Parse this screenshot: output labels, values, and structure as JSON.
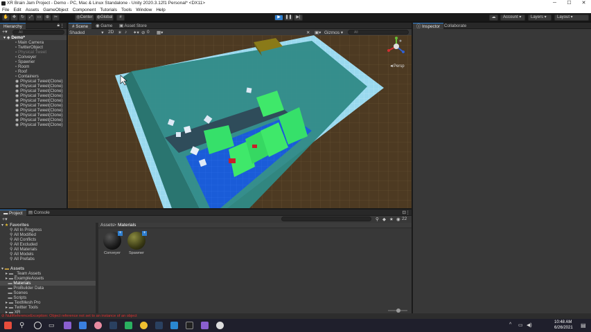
{
  "window": {
    "title": "XR Brain Jam Project - Demo - PC, Mac & Linux Standalone - Unity 2020.3.12f1 Personal* <DX11>",
    "minimize": "─",
    "maximize": "☐",
    "close": "✕"
  },
  "menu": [
    "File",
    "Edit",
    "Assets",
    "GameObject",
    "Component",
    "Tutorials",
    "Tools",
    "Window",
    "Help"
  ],
  "toolbar": {
    "center": "Center",
    "global": "Global",
    "account": "Account",
    "layers": "Layers",
    "layout": "Layout"
  },
  "hierarchy": {
    "tab": "Hierarchy",
    "search_placeholder": "All",
    "scene": "Demo*",
    "items": [
      "Main Camera",
      "TwitterObject",
      "Physical Tweet",
      "Conveyer",
      "Spawner",
      "Room",
      "Roof",
      "Containers",
      "Physical Tweet(Clone)",
      "Physical Tweet(Clone)",
      "Physical Tweet(Clone)",
      "Physical Tweet(Clone)",
      "Physical Tweet(Clone)",
      "Physical Tweet(Clone)",
      "Physical Tweet(Clone)",
      "Physical Tweet(Clone)",
      "Physical Tweet(Clone)",
      "Physical Tweet(Clone)"
    ]
  },
  "scene": {
    "tabs": [
      "Scene",
      "Game",
      "Asset Store"
    ],
    "shading": "Shaded",
    "mode2d": "2D",
    "gizmos": "Gizmos",
    "search": "All",
    "persp": "◄Persp",
    "zero": "0"
  },
  "inspector": {
    "tabs": [
      "Inspector",
      "Collaborate"
    ]
  },
  "project": {
    "tabs": [
      "Project",
      "Console"
    ],
    "breadcrumb": [
      "Assets",
      "Materials"
    ],
    "count": "22",
    "favorites_label": "Favorites",
    "favorites": [
      "All In Progress",
      "All Modified",
      "All Conflicts",
      "All Excluded",
      "All Materials",
      "All Models",
      "All Prefabs"
    ],
    "assets_label": "Assets",
    "folders": [
      "_Team Assets",
      "ExampleAssets",
      "Materials",
      "ProBuilder Data",
      "Scenes",
      "Scripts",
      "TextMesh Pro",
      "Twitter Tools",
      "XR"
    ],
    "materials": [
      {
        "name": "Conveyer",
        "color": "#1a1a1a"
      },
      {
        "name": "Spawner",
        "color": "#5a5a20"
      }
    ]
  },
  "status": "NullReferenceException: Object reference not set to an instance of an object",
  "taskbar": {
    "time": "10:48 AM",
    "date": "6/26/2021"
  },
  "colors": {
    "accent": "#2f7fd0",
    "floor_blue": "#1a5cd8",
    "wall_cyan": "#8fd8ee",
    "green": "#3fe86a",
    "ground": "#4d3a22"
  }
}
